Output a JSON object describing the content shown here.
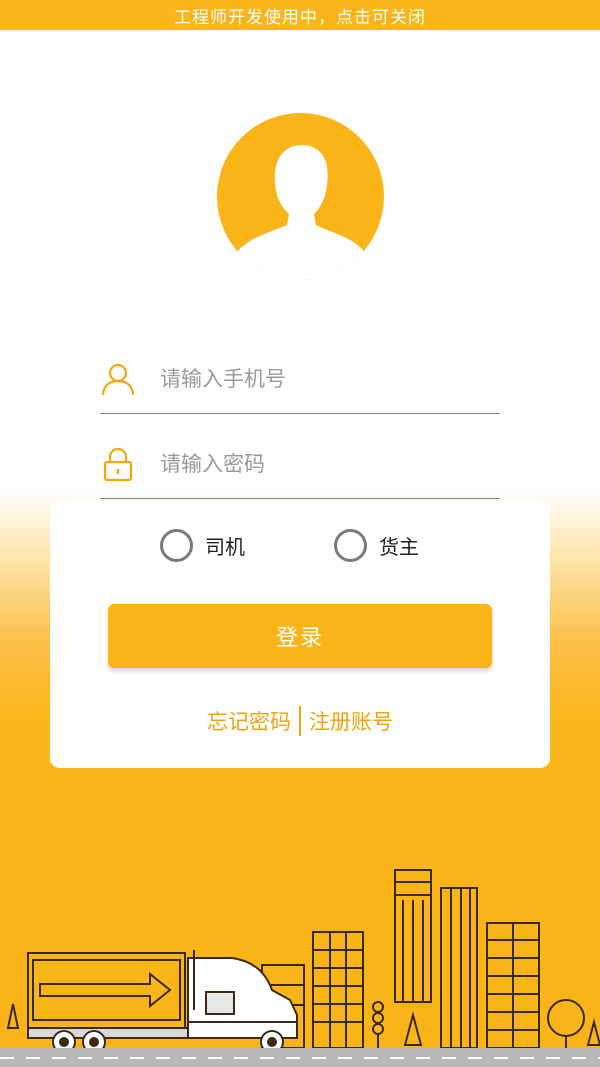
{
  "banner": {
    "text": "工程师开发使用中，点击可关闭"
  },
  "login": {
    "phone_placeholder": "请输入手机号",
    "password_placeholder": "请输入密码",
    "roles": [
      {
        "label": "司机",
        "selected": false
      },
      {
        "label": "货主",
        "selected": false
      }
    ],
    "submit_label": "登录",
    "forgot_label": "忘记密码",
    "register_label": "注册账号"
  },
  "icons": {
    "avatar": "user-silhouette-icon",
    "phone": "user-icon",
    "password": "lock-icon",
    "illustration": "truck-city-illustration"
  },
  "colors": {
    "accent": "#fbb519",
    "link": "#f1a40e",
    "radio_border": "#7a7a7a",
    "divider": "#8a8a8a"
  }
}
